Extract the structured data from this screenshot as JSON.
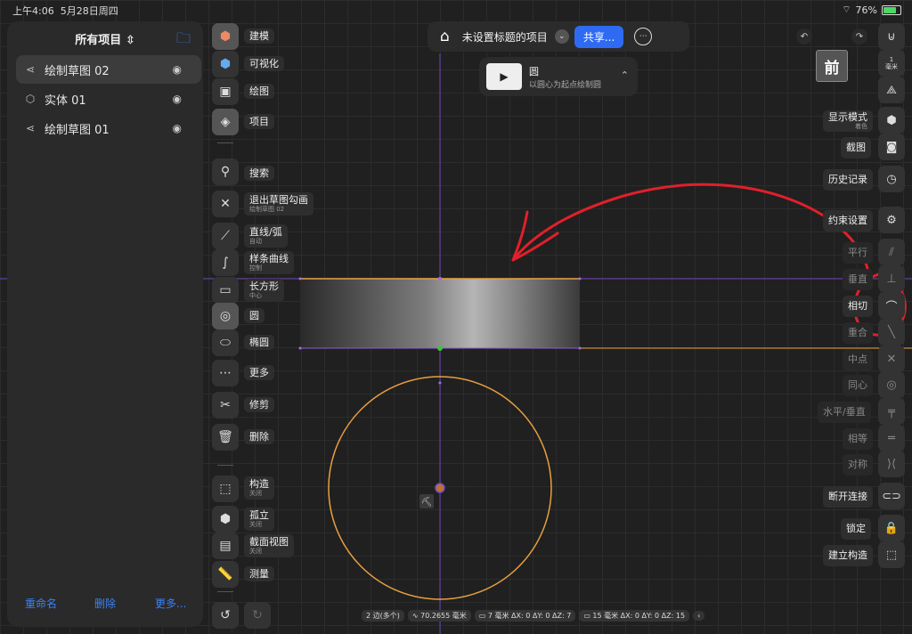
{
  "status_bar": {
    "time": "上午4:06",
    "date": "5月28日周四",
    "battery": "76%"
  },
  "left_panel": {
    "title": "所有项目",
    "items": [
      {
        "label": "绘制草图 02",
        "icon": "sketch-icon"
      },
      {
        "label": "实体  01",
        "icon": "cube-icon"
      },
      {
        "label": "绘制草图 01",
        "icon": "sketch-icon"
      }
    ],
    "footer": {
      "rename": "重命名",
      "delete": "删除",
      "more": "更多..."
    }
  },
  "tools": {
    "model": "建模",
    "visualize": "可视化",
    "drawing": "绘图",
    "project": "项目",
    "search": "搜索",
    "exit_sketch": "退出草图勾画",
    "exit_sketch_sub": "绘制草图 02",
    "line": "直线/弧",
    "line_sub": "自动",
    "spline": "样条曲线",
    "spline_sub": "控制",
    "rect": "长方形",
    "rect_sub": "中心",
    "circle": "圆",
    "ellipse": "椭圆",
    "more": "更多",
    "trim": "修剪",
    "delete": "删除",
    "construct": "构造",
    "construct_sub": "关闭",
    "isolate": "孤立",
    "isolate_sub": "关闭",
    "section": "截面视图",
    "section_sub": "关闭",
    "measure": "测量"
  },
  "top_bar": {
    "title": "未设置标题的项目",
    "share": "共享..."
  },
  "hint": {
    "title": "圆",
    "subtitle": "以圆心为起点绘制圆"
  },
  "view": {
    "cube_face": "前",
    "scale_top": "1",
    "scale_unit": "毫米"
  },
  "right_panel": {
    "display_mode": "显示模式",
    "display_mode_sub": "着色",
    "screenshot": "截图",
    "history": "历史记录",
    "constraint_settings": "约束设置",
    "parallel": "平行",
    "perpendicular": "垂直",
    "tangent": "相切",
    "coincident": "重合",
    "midpoint": "中点",
    "concentric": "同心",
    "horiz_vert": "水平/垂直",
    "equal": "相等",
    "symmetric": "对称",
    "disconnect": "断开连接",
    "lock": "锁定",
    "make_construction": "建立构造"
  },
  "bottom_bar": {
    "edges": "2 边(多个)",
    "length": "70.2655 毫米",
    "dim1": "7 毫米  ΔX: 0  ΔY: 0  ΔZ: 7",
    "dim2": "15 毫米  ΔX: 0  ΔY: 0  ΔZ: 15"
  },
  "colors": {
    "accent": "#2f6bf2",
    "sketch": "#e8a040",
    "annotation": "#e0202a",
    "axis": "#7a3fd0"
  }
}
